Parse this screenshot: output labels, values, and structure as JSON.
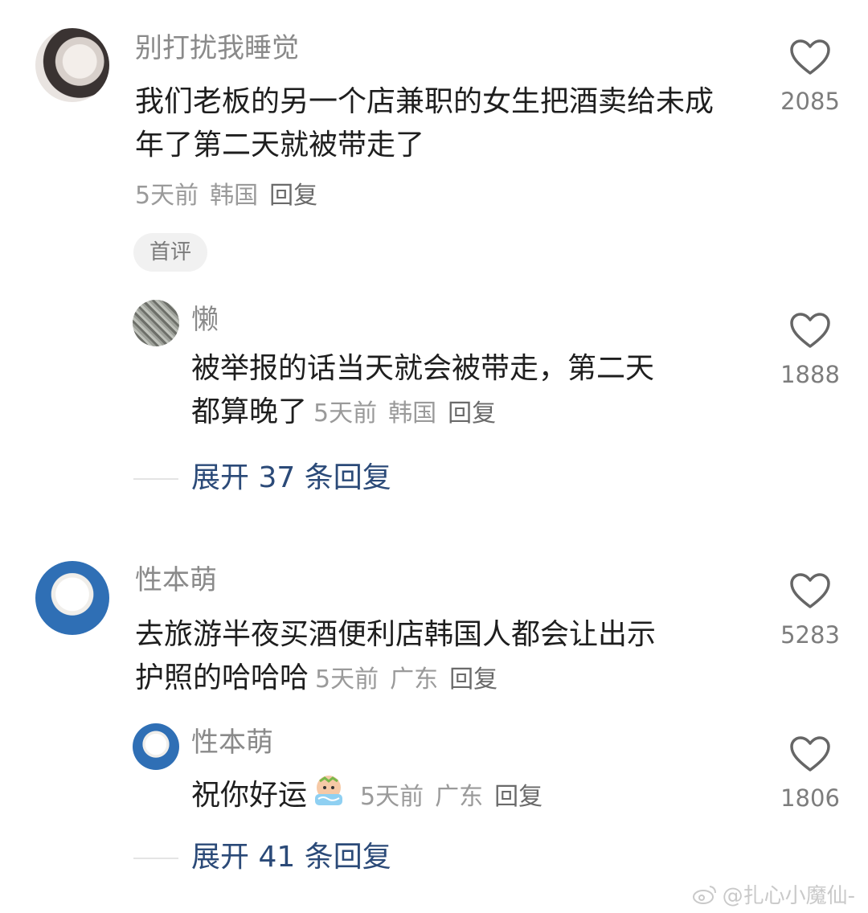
{
  "comments": [
    {
      "username": "别打扰我睡觉",
      "text": "我们老板的另一个店兼职的女生把酒卖给未成年了第二天就被带走了",
      "time": "5天前",
      "location": "韩国",
      "reply_label": "回复",
      "likes": "2085",
      "badge": "首评",
      "replies": [
        {
          "username": "懒",
          "text_line1": "被举报的话当天就会被带走，第二天",
          "text_line2": "都算晚了",
          "time": "5天前",
          "location": "韩国",
          "reply_label": "回复",
          "likes": "1888"
        }
      ],
      "expand_label": "展开 37 条回复"
    },
    {
      "username": "性本萌",
      "text_line1": "去旅游半夜买酒便利店韩国人都会让出示",
      "text_line2": "护照的哈哈哈",
      "time": "5天前",
      "location": "广东",
      "reply_label": "回复",
      "likes": "5283",
      "replies": [
        {
          "username": "性本萌",
          "text": "祝你好运",
          "emoji": "crying-emoji",
          "time": "5天前",
          "location": "广东",
          "reply_label": "回复",
          "likes": "1806"
        }
      ],
      "expand_label": "展开 41 条回复"
    }
  ],
  "watermark": "@扎心小魔仙-",
  "colors": {
    "username": "#8a8a8a",
    "text": "#1e1e1e",
    "meta": "#9a9a9a",
    "expand": "#2b4a78",
    "like_icon": "#666666"
  }
}
